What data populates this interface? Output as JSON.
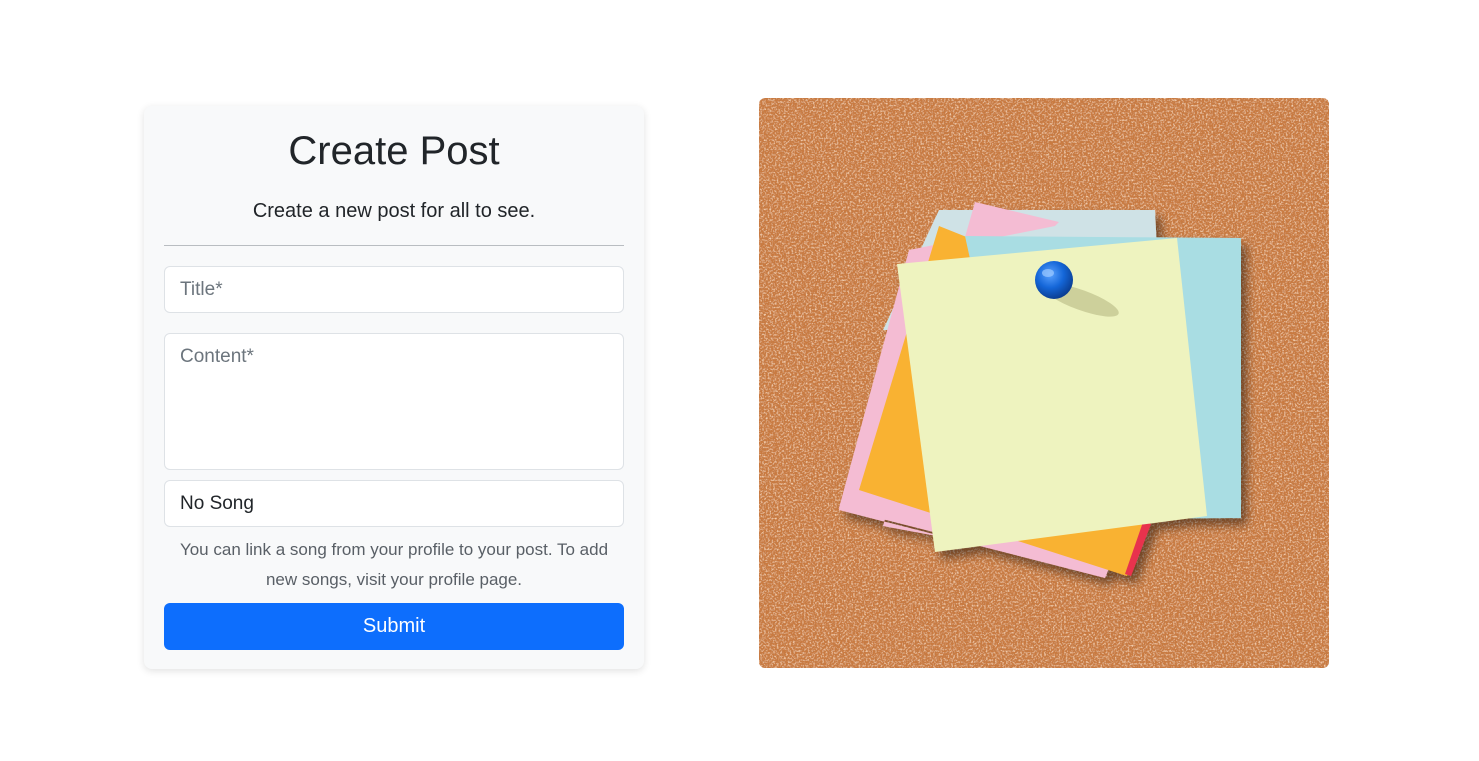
{
  "form": {
    "title": "Create Post",
    "subtitle": "Create a new post for all to see.",
    "title_placeholder": "Title*",
    "title_value": "",
    "content_placeholder": "Content*",
    "content_value": "",
    "song_selected": "No Song",
    "help_text": "You can link a song from your profile to your post. To add new songs, visit your profile page.",
    "submit_label": "Submit",
    "accent_color": "#0d6efd"
  },
  "illustration": {
    "subject": "sticky-notes-pinned-on-corkboard",
    "colors": {
      "cork": "#c97a3f",
      "note_yellow": "#eef3bf",
      "note_blue": "#a9dde3",
      "note_orange": "#f9b232",
      "note_pink": "#f4bcd3",
      "pin": "#1466d8"
    }
  }
}
